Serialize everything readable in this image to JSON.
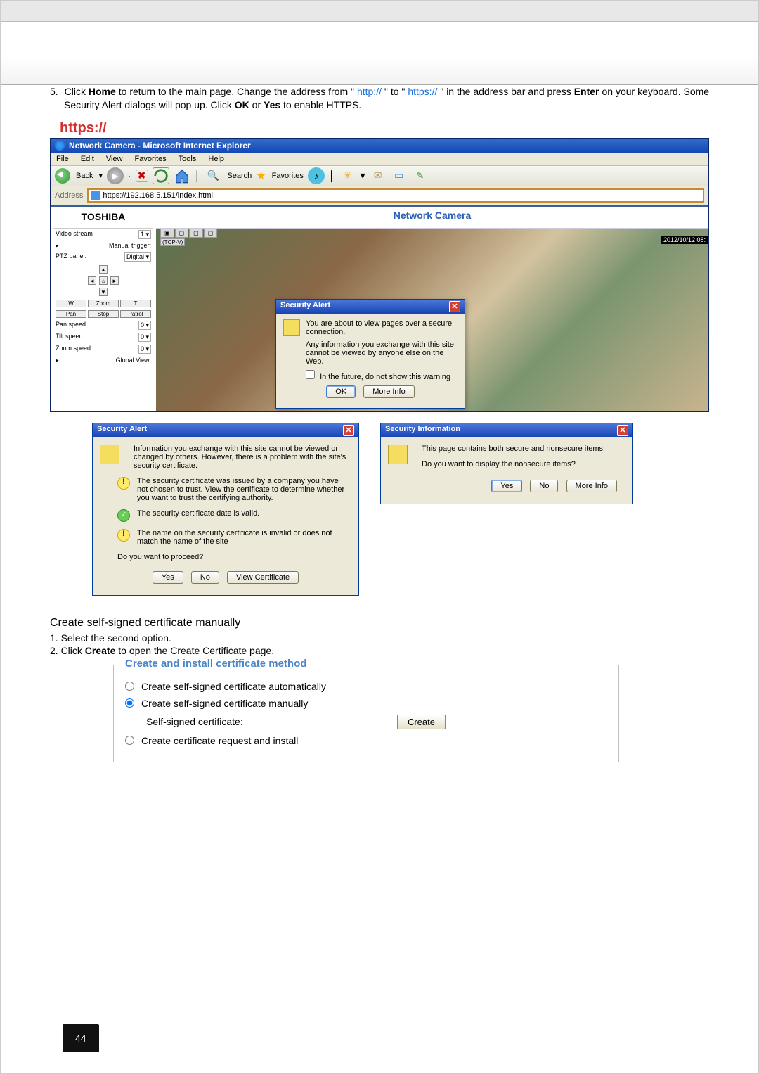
{
  "instruction5": {
    "num": "5.",
    "pre": "Click ",
    "bold1": "Home",
    "mid1": " to return to the main page. Change the address from \"",
    "link1": "http://",
    "mid2": "\" to \"",
    "link2": "https://",
    "mid3": "\" in the address bar and press ",
    "bold2": "Enter",
    "mid4": " on your keyboard. Some Security Alert dialogs will pop up. Click ",
    "bold3": "OK",
    "or": " or ",
    "bold4": "Yes",
    "tail": " to enable HTTPS."
  },
  "https_label": "https://",
  "ie": {
    "title": "Network Camera - Microsoft Internet Explorer",
    "menu": [
      "File",
      "Edit",
      "View",
      "Favorites",
      "Tools",
      "Help"
    ],
    "back": "Back",
    "search": "Search",
    "favorites": "Favorites",
    "addr_label": "Address",
    "addr_https": "https://",
    "addr_rest": "192.168.5.151/index.html"
  },
  "camera": {
    "brand": "TOSHIBA",
    "title": "Network Camera",
    "rows": {
      "video_stream": "Video stream",
      "vs_val": "1",
      "manual_trigger": "Manual trigger:",
      "ptz_panel": "PTZ panel:",
      "ptz_val": "Digital",
      "pan_speed": "Pan speed",
      "tilt_speed": "Tilt speed",
      "zoom_speed": "Zoom speed",
      "speed_val": "0",
      "global_view": "Global View:"
    },
    "wzt": {
      "w": "W",
      "zoom": "Zoom",
      "t": "T"
    },
    "pan_row": {
      "pan": "Pan",
      "stop": "Stop",
      "patrol": "Patrol"
    },
    "tcp": "(TCP-V)",
    "date": "2012/10/12 08:"
  },
  "sec_alert": {
    "title": "Security Alert",
    "line1": "You are about to view pages over a secure connection.",
    "line2": "Any information you exchange with this site cannot be viewed by anyone else on the Web.",
    "chk": "In the future, do not show this warning",
    "ok": "OK",
    "more": "More Info"
  },
  "dialog2": {
    "title": "Security Alert",
    "p1": "Information you exchange with this site cannot be viewed or changed by others. However, there is a problem with the site's security certificate.",
    "b1": "The security certificate was issued by a company you have not chosen to trust. View the certificate to determine whether you want to trust the certifying authority.",
    "b2": "The security certificate date is valid.",
    "b3": "The name on the security certificate is invalid or does not match the name of the site",
    "proceed": "Do you want to proceed?",
    "yes": "Yes",
    "no": "No",
    "view": "View Certificate"
  },
  "dialog3": {
    "title": "Security Information",
    "p1": "This page contains both secure and nonsecure items.",
    "p2": "Do you want to display the nonsecure items?",
    "yes": "Yes",
    "no": "No",
    "more": "More Info"
  },
  "create": {
    "heading": "Create self-signed certificate manually",
    "step1": "1. Select the second option.",
    "step2_a": "2. Click ",
    "step2_b": "Create",
    "step2_c": " to open the Create Certificate page."
  },
  "cert": {
    "legend": "Create and install certificate method",
    "opt1": "Create self-signed certificate automatically",
    "opt2": "Create self-signed certificate manually",
    "sub_label": "Self-signed certificate:",
    "create_btn": "Create",
    "opt3": "Create certificate request and install"
  },
  "page_number": "44"
}
